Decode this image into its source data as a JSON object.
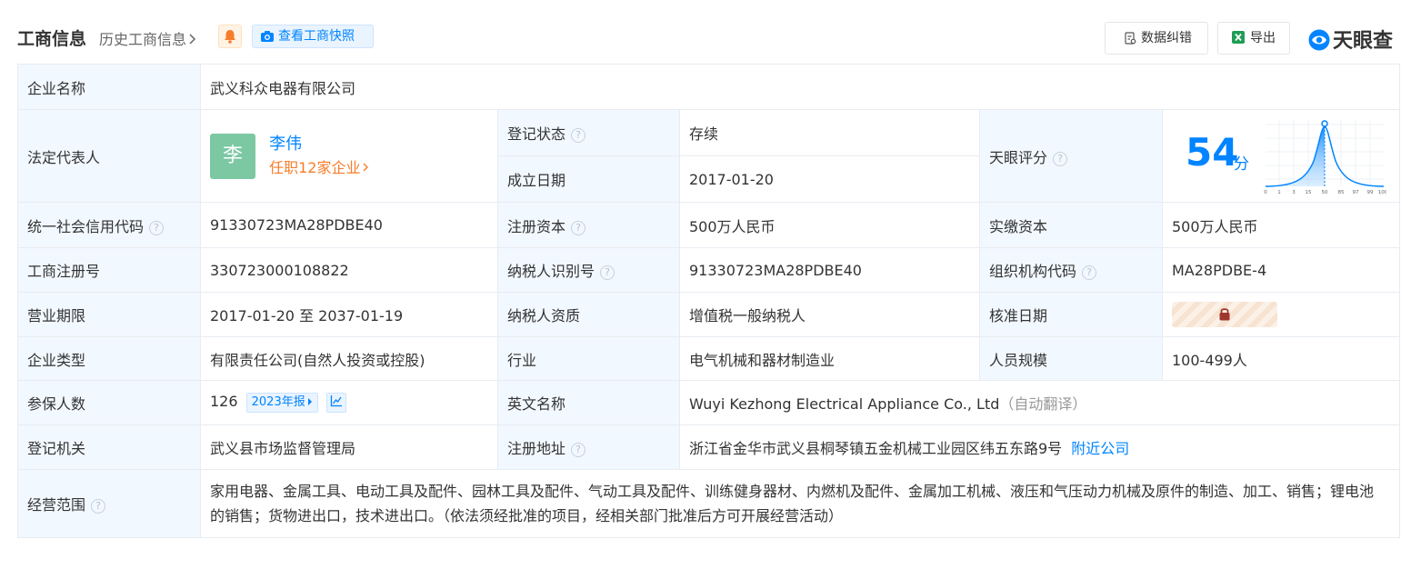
{
  "header": {
    "title": "工商信息",
    "history_link": "历史工商信息",
    "snapshot_button": "查看工商快照",
    "correct_button": "数据纠错",
    "export_button": "导出",
    "logo_text": "天眼查"
  },
  "company": {
    "label": "企业名称",
    "value": "武义科众电器有限公司"
  },
  "legal_rep": {
    "label": "法定代表人",
    "avatar_char": "李",
    "name": "李伟",
    "positions": "任职12家企业"
  },
  "reg_status": {
    "label": "登记状态",
    "value": "存续"
  },
  "est_date": {
    "label": "成立日期",
    "value": "2017-01-20"
  },
  "tianyan_score": {
    "label": "天眼评分",
    "score": "54",
    "unit": "分",
    "axis_ticks": [
      "0",
      "1",
      "3",
      "15",
      "50",
      "85",
      "97",
      "99",
      "100"
    ],
    "score_fraction": 0.54
  },
  "credit_code": {
    "label": "统一社会信用代码",
    "value": "91330723MA28PDBE40"
  },
  "reg_capital": {
    "label": "注册资本",
    "value": "500万人民币"
  },
  "paid_capital": {
    "label": "实缴资本",
    "value": "500万人民币"
  },
  "biz_reg_no": {
    "label": "工商注册号",
    "value": "330723000108822"
  },
  "taxpayer_id": {
    "label": "纳税人识别号",
    "value": "91330723MA28PDBE40"
  },
  "org_code": {
    "label": "组织机构代码",
    "value": "MA28PDBE-4"
  },
  "biz_term": {
    "label": "营业期限",
    "value": "2017-01-20 至 2037-01-19"
  },
  "taxpayer_quality": {
    "label": "纳税人资质",
    "value": "增值税一般纳税人"
  },
  "approval_date": {
    "label": "核准日期"
  },
  "company_type": {
    "label": "企业类型",
    "value": "有限责任公司(自然人投资或控股)"
  },
  "industry": {
    "label": "行业",
    "value": "电气机械和器材制造业"
  },
  "staff_size": {
    "label": "人员规模",
    "value": "100-499人"
  },
  "insured": {
    "label": "参保人数",
    "value": "126",
    "report_tag": "2023年报"
  },
  "english_name": {
    "label": "英文名称",
    "value": "Wuyi Kezhong Electrical Appliance Co., Ltd",
    "note": "（自动翻译）"
  },
  "reg_authority": {
    "label": "登记机关",
    "value": "武义县市场监督管理局"
  },
  "reg_address": {
    "label": "注册地址",
    "value": "浙江省金华市武义县桐琴镇五金机械工业园区纬五东路9号",
    "nearby_link": "附近公司"
  },
  "biz_scope": {
    "label": "经营范围",
    "value": "家用电器、金属工具、电动工具及配件、园林工具及配件、气动工具及配件、训练健身器材、内燃机及配件、金属加工机械、液压和气压动力机械及原件的制造、加工、销售；锂电池的销售；货物进出口，技术进出口。（依法须经批准的项目，经相关部门批准后方可开展经营活动）"
  },
  "colors": {
    "accent": "#0084ff",
    "label_bg": "#f2f8ff",
    "status_green": "#28a745",
    "orange": "#f67d2a"
  }
}
